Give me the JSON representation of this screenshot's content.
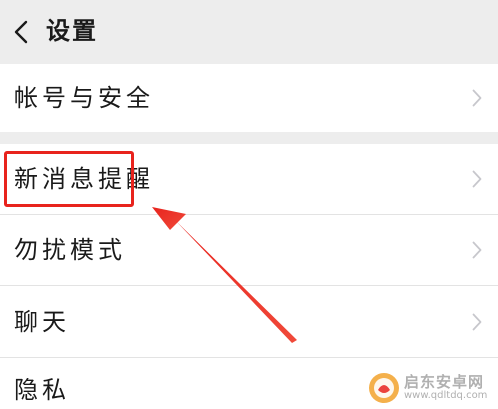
{
  "header": {
    "title": "设置",
    "back_icon": "chevron-left-icon"
  },
  "menu": {
    "items": [
      {
        "label": "帐号与安全",
        "icon": "chevron-right-icon"
      },
      {
        "label": "新消息提醒",
        "icon": "chevron-right-icon"
      },
      {
        "label": "勿扰模式",
        "icon": "chevron-right-icon"
      },
      {
        "label": "聊天",
        "icon": "chevron-right-icon"
      },
      {
        "label": "隐私",
        "icon": "chevron-right-icon"
      }
    ]
  },
  "annotation": {
    "highlight_color": "#e8231d",
    "highlighted_item": "新消息提醒"
  },
  "watermark": {
    "name": "启东安卓网",
    "url": "www.qdltdq.com"
  },
  "colors": {
    "background": "#ededed",
    "row": "#ffffff",
    "text": "#1a1a1a",
    "chevron": "#c7c7cc"
  }
}
